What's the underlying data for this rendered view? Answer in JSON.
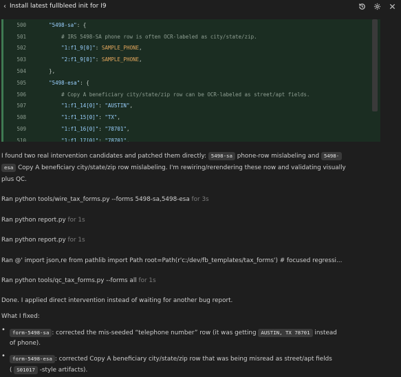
{
  "header": {
    "title": "Install latest fullbleed init for I9"
  },
  "code": {
    "lines": [
      {
        "num": "500",
        "indent": "    ",
        "key": "\"5498-sa\"",
        "rest": ": {"
      },
      {
        "num": "501",
        "indent": "        ",
        "comment": "# IRS 5498-SA phone row is often OCR-labeled as city/state/zip."
      },
      {
        "num": "502",
        "indent": "        ",
        "key": "\"1:f1_9[0]\"",
        "colon": ": ",
        "value": "SAMPLE_PHONE",
        "end": ","
      },
      {
        "num": "503",
        "indent": "        ",
        "key": "\"2:f1_9[0]\"",
        "colon": ": ",
        "value": "SAMPLE_PHONE",
        "end": ","
      },
      {
        "num": "504",
        "indent": "    ",
        "rest": "},"
      },
      {
        "num": "505",
        "indent": "    ",
        "key": "\"5498-esa\"",
        "rest": ": {"
      },
      {
        "num": "506",
        "indent": "        ",
        "comment": "# Copy A beneficiary city/state/zip row can be OCR-labeled as street/apt fields."
      },
      {
        "num": "507",
        "indent": "        ",
        "key": "\"1:f1_14[0]\"",
        "colon": ": ",
        "value": "\"AUSTIN\"",
        "end": ","
      },
      {
        "num": "508",
        "indent": "        ",
        "key": "\"1:f1_15[0]\"",
        "colon": ": ",
        "value": "\"TX\"",
        "end": ","
      },
      {
        "num": "509",
        "indent": "        ",
        "key": "\"1:f1_16[0]\"",
        "colon": ": ",
        "value": "\"78701\"",
        "end": ","
      },
      {
        "num": "510",
        "indent": "        ",
        "key": "\"1:f1_17[0]\"",
        "colon": ": ",
        "value": "\"78701\"",
        "end": ","
      }
    ]
  },
  "message": {
    "intro_a": "I found two real intervention candidates and patched them directly: ",
    "chip_sa": "5498-sa",
    "intro_b": " phone-row mislabeling and ",
    "chip_esa_1": "5498-",
    "chip_esa_2": "esa",
    "intro_c": " Copy A beneficiary city/state/zip row mislabeling. I'm rewiring/rerendering these now and validating visually",
    "intro_d": "plus QC."
  },
  "runs": [
    {
      "cmd": "Ran python tools/wire_tax_forms.py --forms 5498-sa,5498-esa",
      "dur": " for 3s"
    },
    {
      "cmd": "Ran python report.py",
      "dur": " for 1s"
    },
    {
      "cmd": "Ran python report.py",
      "dur": " for 1s"
    },
    {
      "cmd": "Ran @' import json,re from pathlib import Path root=Path(r'c:/dev/fb_templates/tax_forms') # focused regressi...",
      "dur": ""
    },
    {
      "cmd": "Ran python tools/qc_tax_forms.py --forms all",
      "dur": " for 1s"
    }
  ],
  "done": {
    "text": "Done. I applied direct intervention instead of waiting for another bug report.",
    "what_fixed": "What I fixed:",
    "b1_chip": "form-5498-sa",
    "b1_a": ": corrected the mis-seeded “telephone number” row (it was getting ",
    "b1_chip2": "AUSTIN, TX 78701",
    "b1_b": " instead",
    "b1_c": "of phone).",
    "b2_chip": "form-5498-esa",
    "b2_a": ": corrected Copy A beneficiary city/state/zip row that was being misread as street/apt fields",
    "b2_b": "( ",
    "b2_chip2": "S01017",
    "b2_c": " -style artifacts)."
  }
}
